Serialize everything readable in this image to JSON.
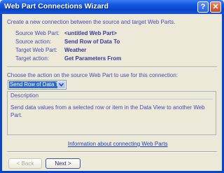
{
  "window": {
    "title": "Web Part Connections Wizard",
    "help_label": "?",
    "close_label": "✕"
  },
  "intro": "Create a new connection between the source and target Web Parts.",
  "details": [
    {
      "label": "Source Web Part:",
      "value": "<untitled Web Part>"
    },
    {
      "label": "Source action:",
      "value": "Send Row of Data To"
    },
    {
      "label": "Target Web Part:",
      "value": "Weather"
    },
    {
      "label": "Target action:",
      "value": "Get Parameters From"
    }
  ],
  "choose_label": "Choose the action on the source Web Part to use for this connection:",
  "action_select": {
    "selected": "Send Row of Data To"
  },
  "description": {
    "title": "Description",
    "text": "Send data values from a selected row or item in the Data View to another Web Part."
  },
  "info_link": "Information about connecting Web Parts",
  "buttons": {
    "back": "< Back",
    "next": "Next >"
  },
  "colors": {
    "title_bar": "#1457e0",
    "dialog_bg": "#ece9d8",
    "label_text": "#4a4ab0",
    "link": "#1a3fb0",
    "selection": "#316ac5"
  }
}
